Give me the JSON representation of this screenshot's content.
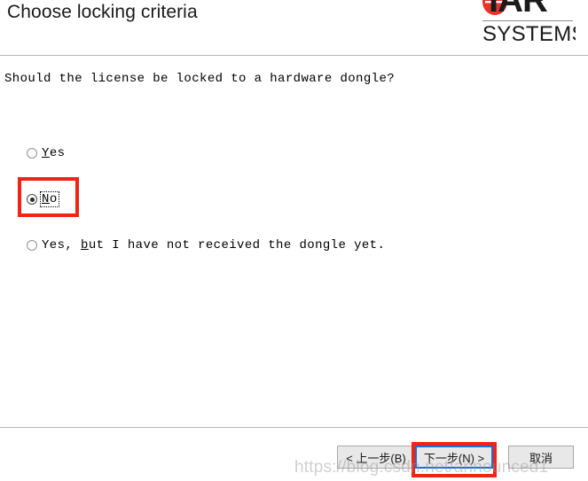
{
  "window": {
    "title": "Choose locking criteria"
  },
  "brand": {
    "logo_mark_icon": "iar-oval-logo-icon",
    "wordmark": "IAR",
    "subwordmark": "SYSTEMS",
    "logo_red": "#e8332a"
  },
  "main": {
    "question": "Should the license be locked to a hardware dongle?",
    "options": [
      {
        "id": "yes",
        "accel": "Y",
        "label_before": "",
        "label_after": "es",
        "checked": false,
        "focused": false
      },
      {
        "id": "no",
        "accel": "N",
        "label_before": "",
        "label_after": "o",
        "checked": true,
        "focused": true
      },
      {
        "id": "yes-not-received",
        "accel": "b",
        "label_before": "Yes, ",
        "label_after": "ut I have not received the dongle yet.",
        "checked": false,
        "focused": false
      }
    ]
  },
  "footer": {
    "back_label": "< 上一步(B)",
    "next_label": "下一步(N) >",
    "cancel_label": "取消",
    "default_button": "next"
  },
  "annotations": {
    "accent_color": "#f02314",
    "focus_border_color": "#1a6fd4",
    "boxes": [
      "no-option",
      "next-button"
    ]
  },
  "watermark": {
    "text": "https://blog.csdn.net/announced1"
  }
}
